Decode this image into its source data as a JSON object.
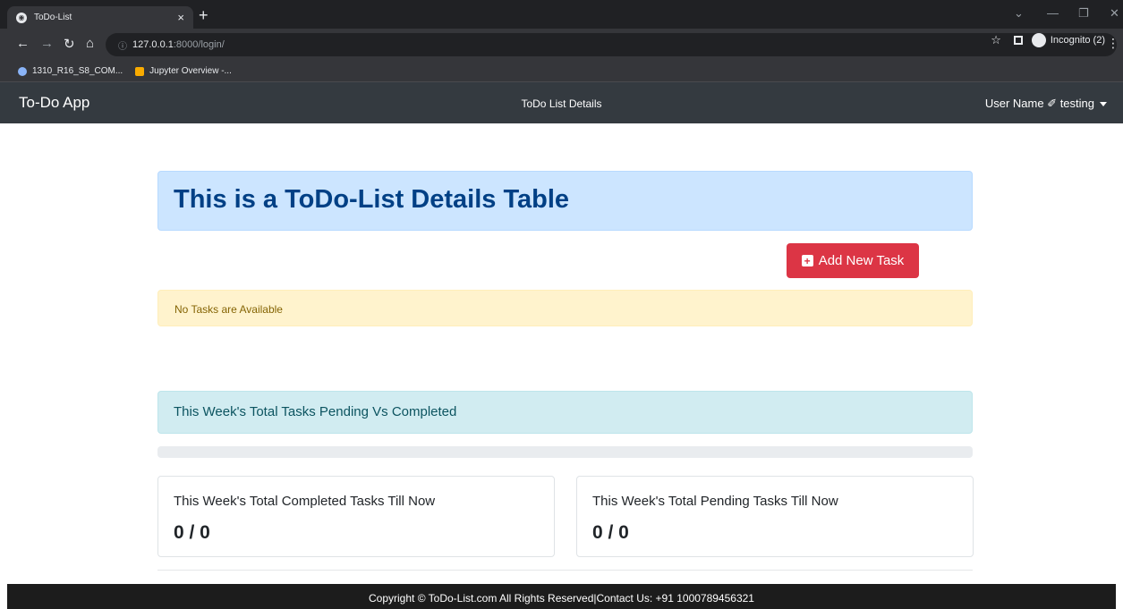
{
  "browser": {
    "tab_title": "ToDo-List",
    "tab_close": "×",
    "new_tab": "+",
    "url_host": "127.0.0.1",
    "url_path": ":8000/login/",
    "profile_label": "Incognito (2)",
    "bookmarks": [
      "1310_R16_S8_COM...",
      "Jupyter Overview -..."
    ]
  },
  "navbar": {
    "brand": "To-Do App",
    "center_title": "ToDo List Details",
    "user_label": "User Name ✐ testing"
  },
  "main": {
    "heading": "This is a ToDo-List Details Table",
    "add_button_label": "Add New Task",
    "empty_message": "No Tasks are Available",
    "summary_heading": "This Week's Total Tasks Pending Vs Completed",
    "progress_fraction": 0,
    "cards": [
      {
        "title": "This Week's Total Completed Tasks Till Now",
        "value": "0 / 0"
      },
      {
        "title": "This Week's Total Pending Tasks Till Now",
        "value": "0 / 0"
      }
    ]
  },
  "footer": {
    "text": "Copyright © ToDo-List.com All Rights Reserved|Contact Us: +91 1000789456321"
  },
  "colors": {
    "navbar": "#343a40",
    "primary_alert": "#cce5ff",
    "danger": "#dc3545",
    "warning_alert": "#fff3cd",
    "info_alert": "#d1ecf1"
  }
}
